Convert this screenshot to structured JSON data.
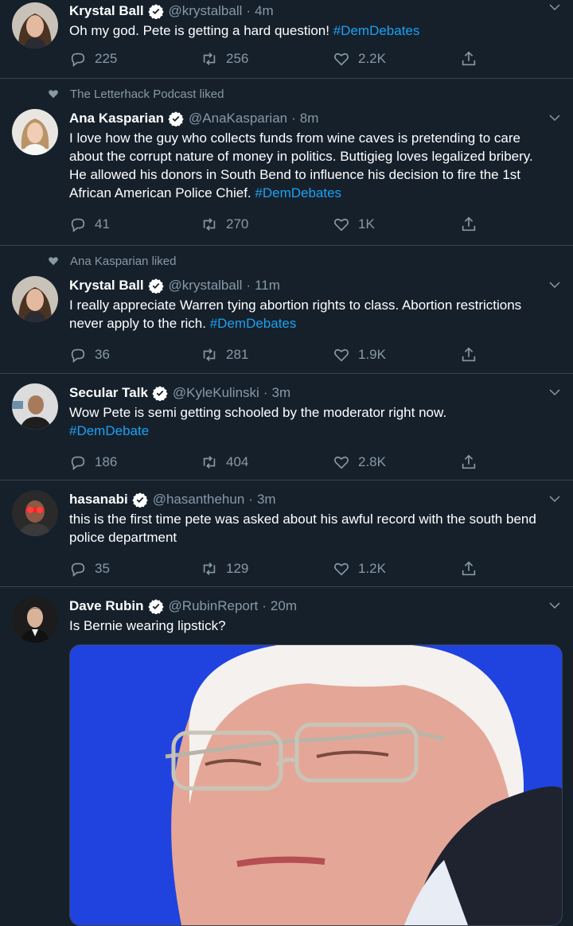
{
  "tweets": [
    {
      "social": "",
      "name": "Krystal Ball",
      "handle": "@krystalball",
      "time": "4m",
      "text": "Oh my god. Pete is getting a hard question!",
      "hashtag": "#DemDebates",
      "reply_count": "225",
      "retweet_count": "256",
      "like_count": "2.2K"
    },
    {
      "social": "The Letterhack Podcast liked",
      "name": "Ana Kasparian",
      "handle": "@AnaKasparian",
      "time": "8m",
      "text": "I love how the guy who collects funds from wine caves is pretending to care about the corrupt nature of money in politics. Buttigieg loves legalized bribery. He allowed his donors in South Bend to influence his decision to fire the 1st African American Police Chief.",
      "hashtag": "#DemDebates",
      "reply_count": "41",
      "retweet_count": "270",
      "like_count": "1K"
    },
    {
      "social": "Ana Kasparian liked",
      "name": "Krystal Ball",
      "handle": "@krystalball",
      "time": "11m",
      "text": "I really appreciate Warren tying abortion rights to class.  Abortion restrictions never apply to the rich.",
      "hashtag": "#DemDebates",
      "reply_count": "36",
      "retweet_count": "281",
      "like_count": "1.9K"
    },
    {
      "social": "",
      "name": "Secular Talk",
      "handle": "@KyleKulinski",
      "time": "3m",
      "text": "Wow Pete is semi getting schooled by the moderator right now.",
      "hashtag": "#DemDebate",
      "reply_count": "186",
      "retweet_count": "404",
      "like_count": "2.8K"
    },
    {
      "social": "",
      "name": "hasanabi",
      "handle": "@hasanthehun",
      "time": "3m",
      "text": "this is the first time pete was asked about his awful record with the south bend police department",
      "hashtag": "",
      "reply_count": "35",
      "retweet_count": "129",
      "like_count": "1.2K"
    },
    {
      "social": "",
      "name": "Dave Rubin",
      "handle": "@RubinReport",
      "time": "20m",
      "text": "Is Bernie wearing lipstick?",
      "hashtag": "",
      "reply_count": "",
      "retweet_count": "",
      "like_count": ""
    }
  ],
  "colors": {
    "background": "#15202b",
    "divider": "#38444d",
    "secondary_text": "#8899a6",
    "link": "#1da1f2",
    "verified": "#ffffff"
  },
  "icons": [
    "verified-badge-icon",
    "chevron-down-icon",
    "reply-icon",
    "retweet-icon",
    "like-icon",
    "share-icon",
    "heart-icon"
  ]
}
